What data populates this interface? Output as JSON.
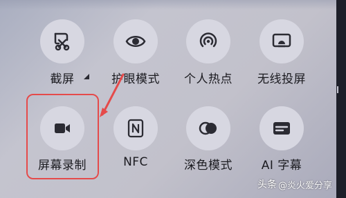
{
  "panel": {
    "tiles": [
      {
        "label": "截屏",
        "icon": "scissors-screenshot-icon"
      },
      {
        "label": "护眼模式",
        "icon": "eye-icon"
      },
      {
        "label": "个人热点",
        "icon": "hotspot-icon"
      },
      {
        "label": "无线投屏",
        "icon": "cast-screen-icon"
      },
      {
        "label": "屏幕录制",
        "icon": "video-camera-icon"
      },
      {
        "label": "NFC",
        "icon": "nfc-icon"
      },
      {
        "label": "深色模式",
        "icon": "dark-mode-icon"
      },
      {
        "label": "AI 字幕",
        "icon": "subtitles-icon"
      }
    ]
  },
  "annotation": {
    "highlight_color": "#e54a4a"
  },
  "watermark": {
    "source": "头条",
    "author": "@炎火爱分享"
  },
  "colors": {
    "icon": "#2b2b33",
    "tile_bg": "#d7d7e1"
  }
}
